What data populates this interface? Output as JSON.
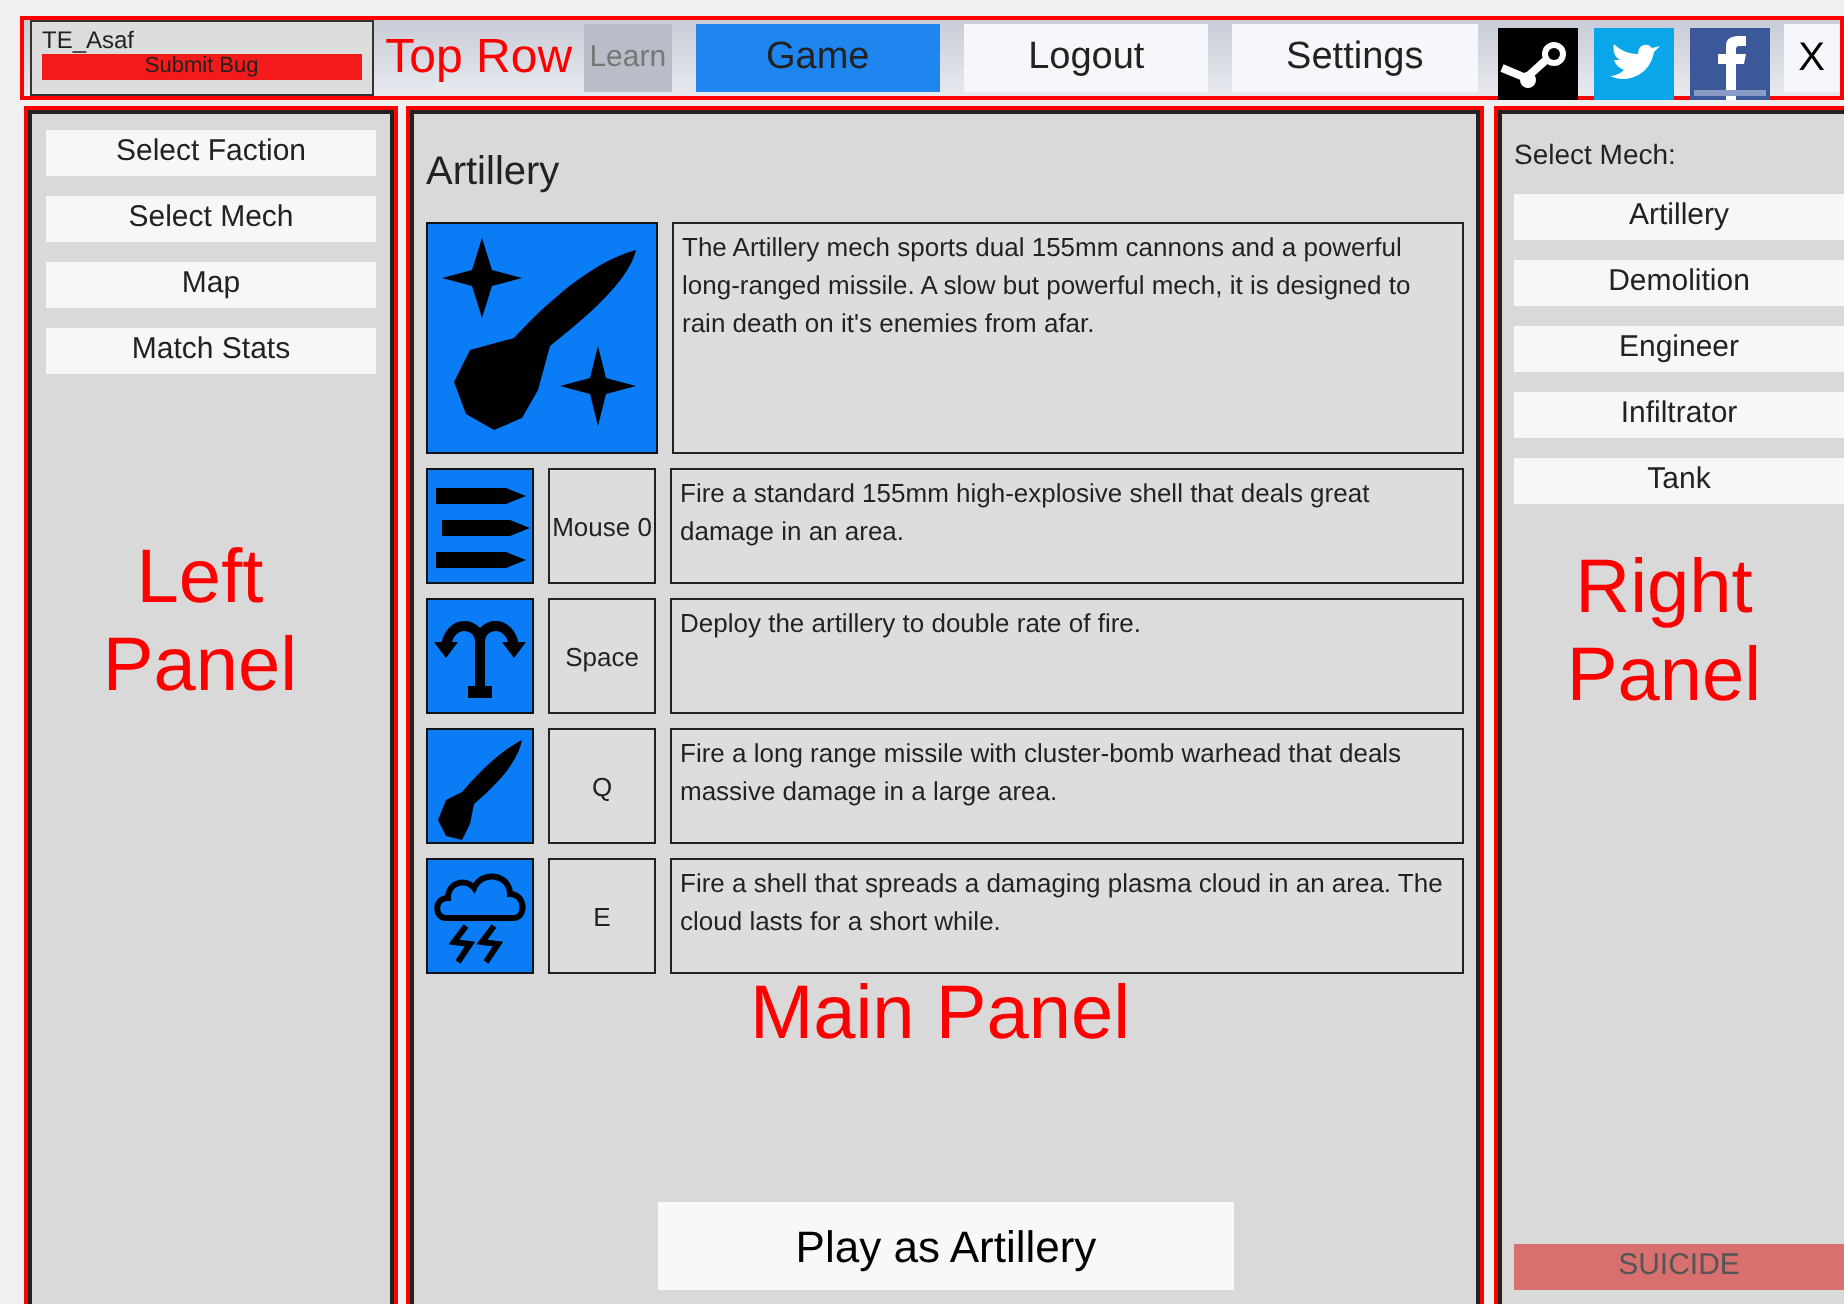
{
  "user": {
    "name": "TE_Asaf",
    "bug_button": "Submit Bug"
  },
  "tabs": [
    {
      "label": "Learn",
      "selected": false
    },
    {
      "label": "Game",
      "selected": true
    },
    {
      "label": "Logout",
      "selected": false
    },
    {
      "label": "Settings",
      "selected": false
    }
  ],
  "close_button": "X",
  "left_panel": {
    "items": [
      "Select Faction",
      "Select Mech",
      "Map",
      "Match Stats"
    ]
  },
  "main_panel": {
    "title": "Artillery",
    "description": "The Artillery mech sports dual 155mm cannons and a powerful long-ranged missile. A slow but powerful mech, it is designed to rain death on it's enemies from afar.",
    "abilities": [
      {
        "kind": "shells",
        "key": "Mouse 0",
        "description": "Fire a standard 155mm high-explosive shell that deals great damage in an area."
      },
      {
        "kind": "deploy",
        "key": "Space",
        "description": "Deploy the artillery to double rate of fire."
      },
      {
        "kind": "missile",
        "key": "Q",
        "description": "Fire a long range missile with cluster-bomb warhead that deals massive damage in a large area."
      },
      {
        "kind": "cloud",
        "key": "E",
        "description": "Fire a shell that spreads a damaging plasma cloud in an area. The cloud lasts for a short while."
      }
    ],
    "play_button": "Play as Artillery"
  },
  "right_panel": {
    "label": "Select Mech:",
    "items": [
      "Artillery",
      "Demolition",
      "Engineer",
      "Infiltrator",
      "Tank"
    ],
    "suicide_button": "SUICIDE"
  },
  "annotations": [
    {
      "kind": "top",
      "text": "Top Row"
    },
    {
      "kind": "left",
      "text": "Left Panel"
    },
    {
      "kind": "main",
      "text": "Main Panel"
    },
    {
      "kind": "right",
      "text": "Right Panel"
    }
  ]
}
